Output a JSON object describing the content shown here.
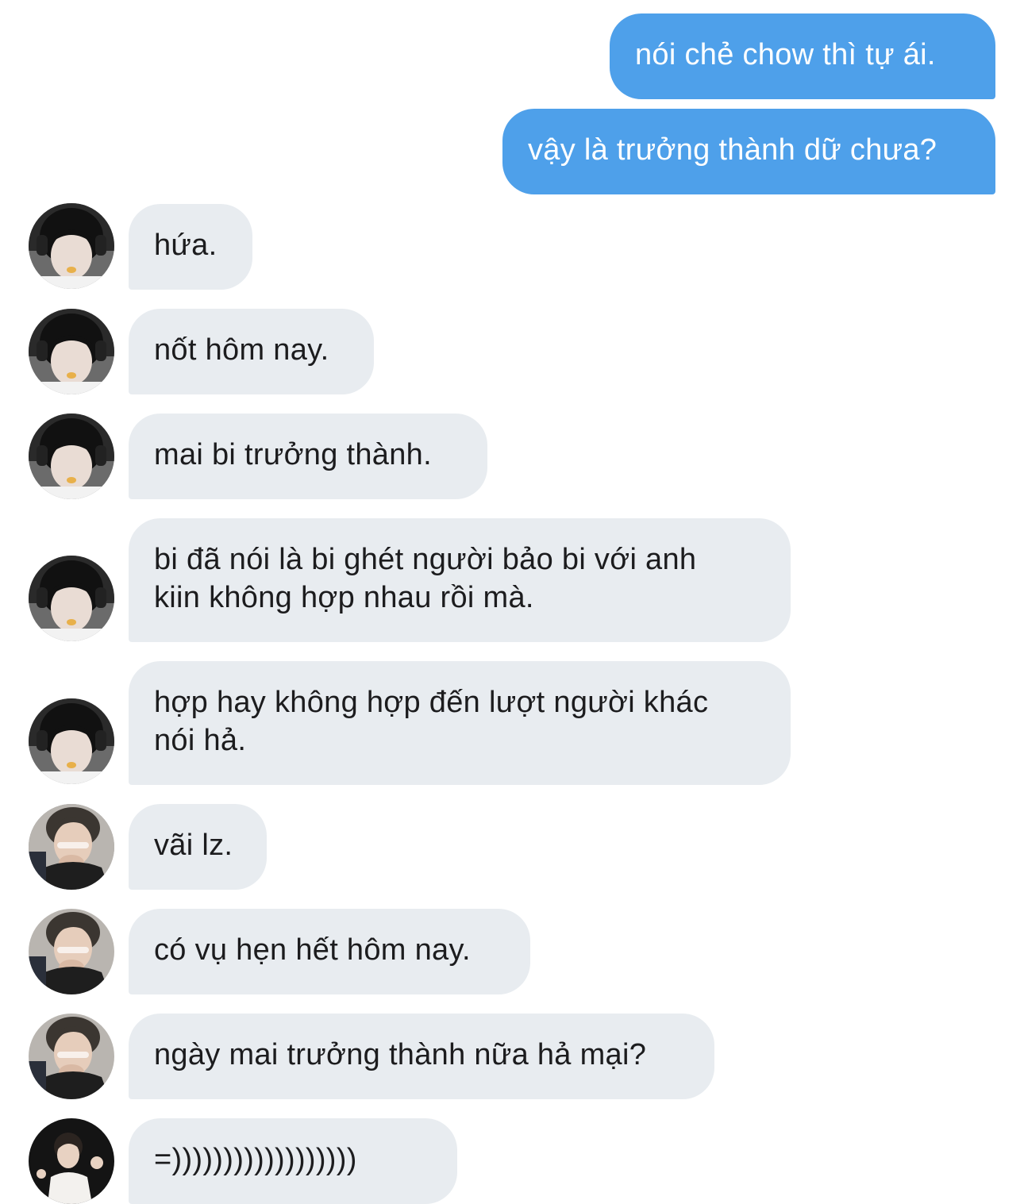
{
  "chat": {
    "messages": [
      {
        "from": "me",
        "text": "nói chẻ chow thì tự ái."
      },
      {
        "from": "me",
        "text": "vậy là trưởng thành dữ chưa?"
      },
      {
        "from": "user_a",
        "avatar": "avatar-a",
        "text": "hứa."
      },
      {
        "from": "user_a",
        "avatar": "avatar-a",
        "text": "nốt hôm nay."
      },
      {
        "from": "user_a",
        "avatar": "avatar-a",
        "text": "mai bi trưởng thành."
      },
      {
        "from": "user_a",
        "avatar": "avatar-a",
        "text": "bi đã nói là bi ghét người bảo bi với anh\nkiin không hợp nhau rồi mà."
      },
      {
        "from": "user_a",
        "avatar": "avatar-a",
        "text": "hợp hay không hợp đến lượt người khác\nnói hả."
      },
      {
        "from": "user_b",
        "avatar": "avatar-b",
        "text": "vãi lz."
      },
      {
        "from": "user_b",
        "avatar": "avatar-b",
        "text": "có vụ hẹn hết hôm nay."
      },
      {
        "from": "user_b",
        "avatar": "avatar-b",
        "text": "ngày mai trưởng thành nữa hả mại?"
      },
      {
        "from": "user_c",
        "avatar": "avatar-c",
        "text": "=))))))))))))))))))"
      }
    ]
  },
  "colors": {
    "sent_bubble": "#4ea0ea",
    "received_bubble": "#e8ecf0",
    "sent_text": "#ffffff",
    "received_text": "#1c1c1e"
  }
}
